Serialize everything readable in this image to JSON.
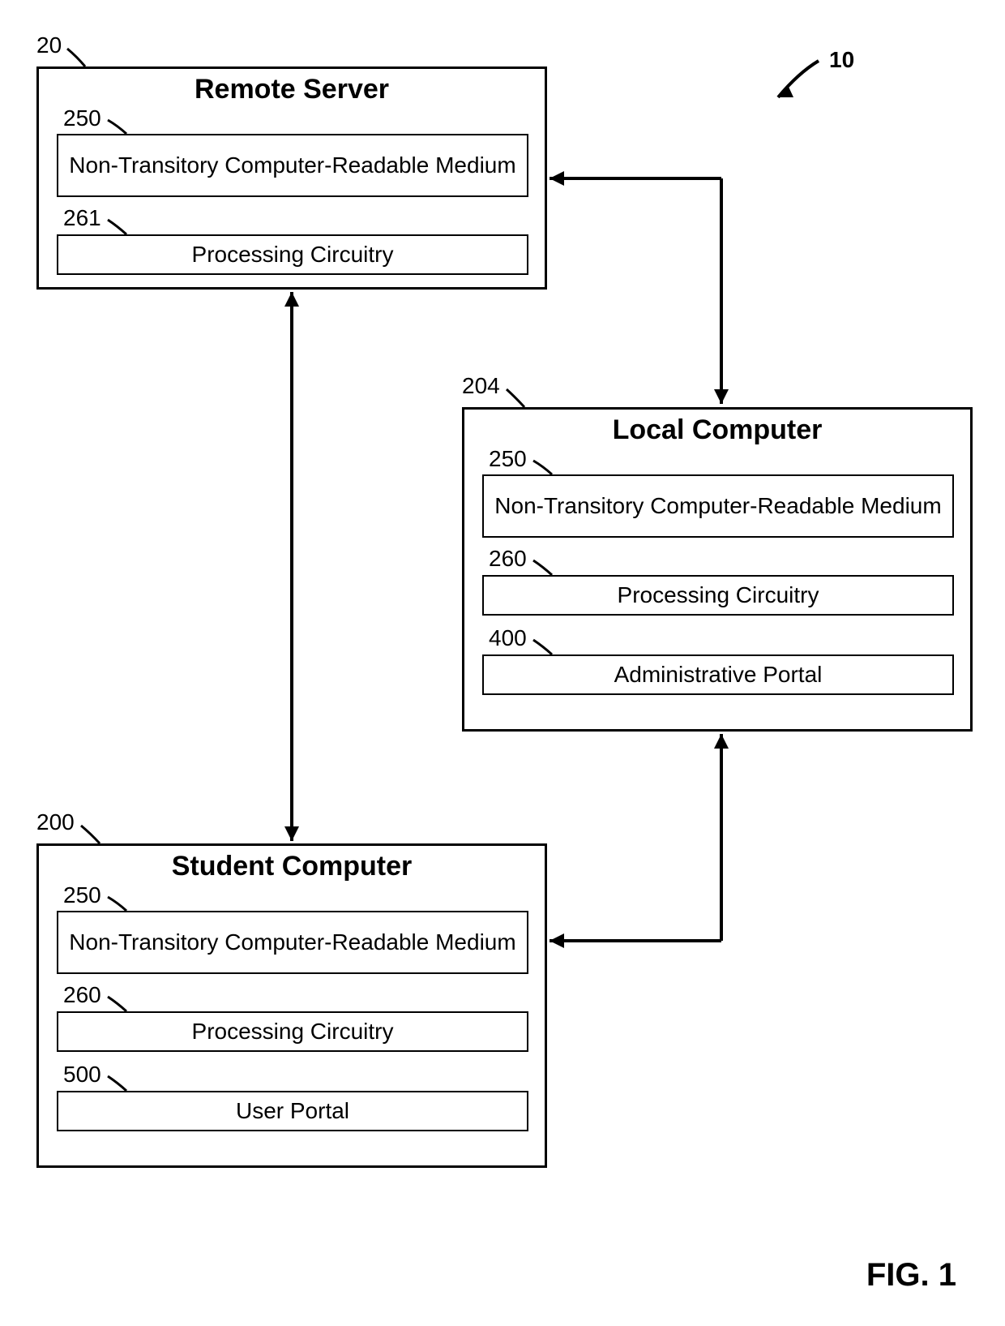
{
  "figure_label": "FIG. 1",
  "system_ref": "10",
  "blocks": {
    "remote_server": {
      "ref": "20",
      "title": "Remote Server",
      "subs": [
        {
          "ref": "250",
          "label": "Non-Transitory Computer-Readable Medium"
        },
        {
          "ref": "261",
          "label": "Processing Circuitry"
        }
      ]
    },
    "local_computer": {
      "ref": "204",
      "title": "Local Computer",
      "subs": [
        {
          "ref": "250",
          "label": "Non-Transitory Computer-Readable Medium"
        },
        {
          "ref": "260",
          "label": "Processing Circuitry"
        },
        {
          "ref": "400",
          "label": "Administrative Portal"
        }
      ]
    },
    "student_computer": {
      "ref": "200",
      "title": "Student Computer",
      "subs": [
        {
          "ref": "250",
          "label": "Non-Transitory Computer-Readable Medium"
        },
        {
          "ref": "260",
          "label": "Processing Circuitry"
        },
        {
          "ref": "500",
          "label": "User Portal"
        }
      ]
    }
  }
}
